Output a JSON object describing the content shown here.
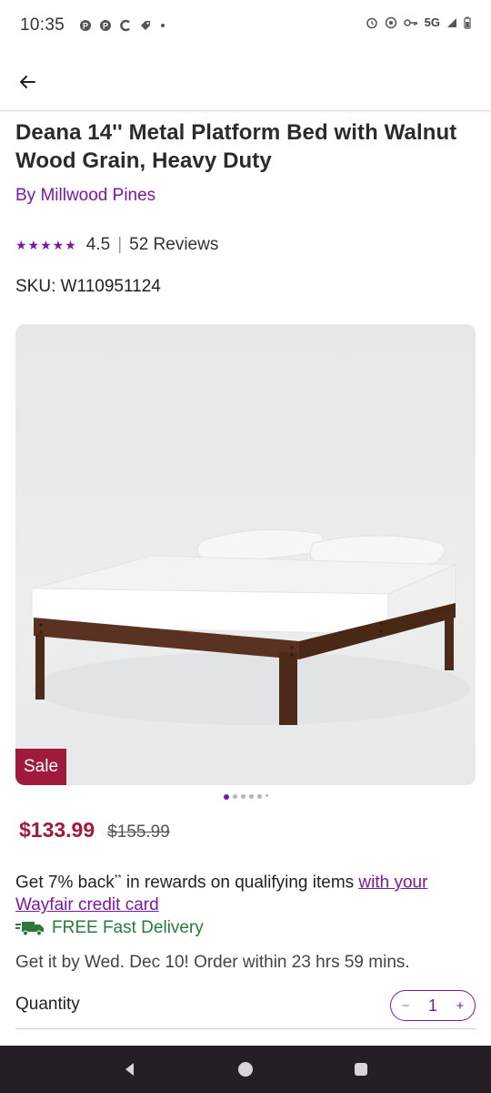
{
  "status_bar": {
    "time": "10:35",
    "left_icons": [
      "pinterest-icon",
      "pinterest-icon",
      "c-app-icon",
      "tag-icon",
      "dot-icon"
    ],
    "right_icons": [
      "alarm-icon",
      "location-icon",
      "key-icon",
      "5g-icon",
      "signal-icon",
      "battery-icon"
    ],
    "network": "5G"
  },
  "header": {
    "back_icon": "arrow-left-icon"
  },
  "product": {
    "title": "Deana 14'' Metal Platform Bed with Walnut Wood Grain,  Heavy Duty",
    "brand": "By Millwood Pines",
    "rating_stars": "★★★★★",
    "rating": "4.5",
    "rating_separator": "|",
    "reviews": "52 Reviews",
    "sku": "SKU: W110951124",
    "sale_badge": "Sale",
    "image_count": 6,
    "active_image_index": 0,
    "sale_price": "$133.99",
    "original_price": "$155.99",
    "rewards_text": "Get 7% back",
    "rewards_sup": "**",
    "rewards_text2": " in rewards on qualifying items ",
    "rewards_link": "with your Wayfair credit card",
    "delivery": "FREE Fast Delivery",
    "eta": "Get it by Wed. Dec 10! Order within 23 hrs 59 mins.",
    "quantity_label": "Quantity",
    "quantity_value": "1",
    "qty_minus": "−",
    "qty_plus": "+"
  },
  "colors": {
    "brand_purple": "#7b189f",
    "sale_red": "#a01a3c",
    "delivery_green": "#2a7b3b",
    "nav_bar": "#251e27"
  },
  "nav": {
    "icons": [
      "back-triangle-icon",
      "home-circle-icon",
      "recents-square-icon"
    ]
  }
}
